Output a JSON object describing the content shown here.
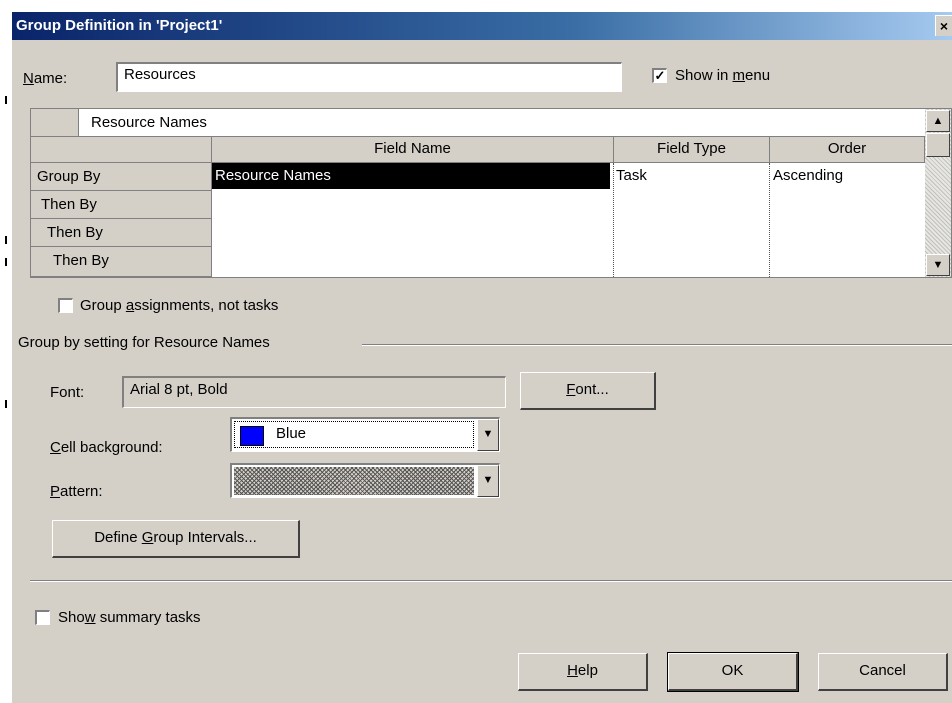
{
  "dialog": {
    "title": "Group Definition in 'Project1'",
    "close_glyph": "×"
  },
  "name_field": {
    "label_accel": "N",
    "label_rest": "ame:",
    "value": "Resources"
  },
  "show_in_menu": {
    "checked": true,
    "check_glyph": "✓",
    "label_pre": "Show in ",
    "label_accel": "m",
    "label_post": "enu"
  },
  "grid": {
    "top_cell": "Resource Names",
    "headers": [
      "Field Name",
      "Field Type",
      "Order"
    ],
    "row_headers": [
      "Group By",
      "Then By",
      "Then By",
      "Then By"
    ],
    "rows": [
      {
        "field_name": "Resource Names",
        "field_type": "Task",
        "order": "Ascending",
        "selected": true
      },
      {
        "field_name": "",
        "field_type": "",
        "order": ""
      },
      {
        "field_name": "",
        "field_type": "",
        "order": ""
      },
      {
        "field_name": "",
        "field_type": "",
        "order": ""
      }
    ],
    "scroll_up_glyph": "▲",
    "scroll_down_glyph": "▼"
  },
  "group_assignments": {
    "checked": false,
    "label_pre": "Group ",
    "label_accel": "a",
    "label_post": "ssignments, not tasks"
  },
  "group_setting": {
    "title": "Group by setting for Resource Names",
    "font_label": "Font:",
    "font_value": "Arial 8 pt, Bold",
    "font_button_accel": "F",
    "font_button_rest": "ont...",
    "cell_bg_label_accel": "C",
    "cell_bg_label_rest": "ell background:",
    "cell_bg_value": "Blue",
    "cell_bg_color": "#0000ff",
    "pattern_label_accel": "P",
    "pattern_label_rest": "attern:",
    "define_intervals_pre": "Define ",
    "define_intervals_accel": "G",
    "define_intervals_post": "roup Intervals...",
    "dropdown_glyph": "▼"
  },
  "show_summary": {
    "checked": false,
    "label_pre": "Sho",
    "label_accel": "w",
    "label_post": " summary tasks"
  },
  "buttons": {
    "help_accel": "H",
    "help_rest": "elp",
    "ok": "OK",
    "cancel": "Cancel"
  }
}
